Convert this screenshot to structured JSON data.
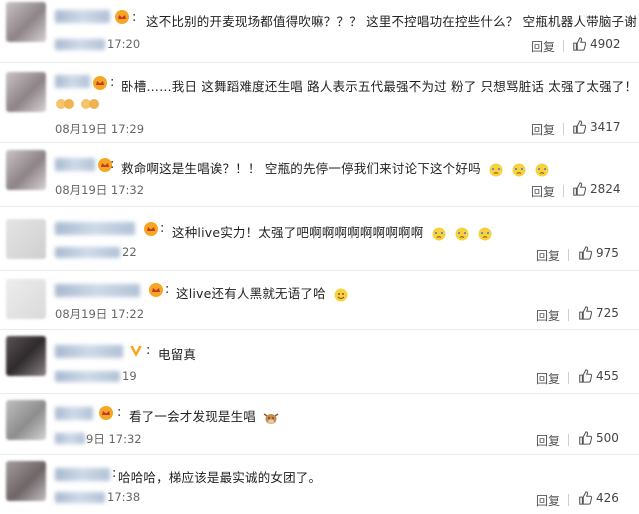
{
  "comments": [
    {
      "text": "这不比别的开麦现场都值得吹嘛？？？ 这里不控唱功在控些什么？ 空瓶机器人带脑子谢",
      "time": "17:20",
      "reply": "回复",
      "likes": "4902"
    },
    {
      "text": "卧槽……我日 这舞蹈难度还生唱 路人表示五代最强不为过 粉了 只想骂脏话 太强了太强了！！",
      "time": "08月19日 17:29",
      "reply": "回复",
      "likes": "3417"
    },
    {
      "text": "救命啊这是生唱诶？！！ 空瓶的先停一停我们来讨论下这个好吗",
      "time": "08月19日 17:32",
      "reply": "回复",
      "likes": "2824"
    },
    {
      "text": "这种live实力！太强了吧啊啊啊啊啊啊啊啊啊",
      "time": "22",
      "reply": "回复",
      "likes": "975"
    },
    {
      "text": "这live还有人黑就无语了哈",
      "time": "08月19日 17:22",
      "reply": "回复",
      "likes": "725"
    },
    {
      "text": "电留真",
      "time": "19",
      "reply": "回复",
      "likes": "455"
    },
    {
      "text": "看了一会才发现是生唱",
      "time": "9日 17:32",
      "reply": "回复",
      "likes": "500"
    },
    {
      "text": "哈哈哈，梯应该是最实诚的女团了。",
      "time": "17:38",
      "reply": "回复",
      "likes": "426"
    }
  ],
  "icons": {
    "like": "thumbs-up-icon",
    "badge": "vip-crown-icon"
  },
  "colors": {
    "badge": "#f6a623",
    "like": "#555555",
    "reply": "#555555"
  }
}
